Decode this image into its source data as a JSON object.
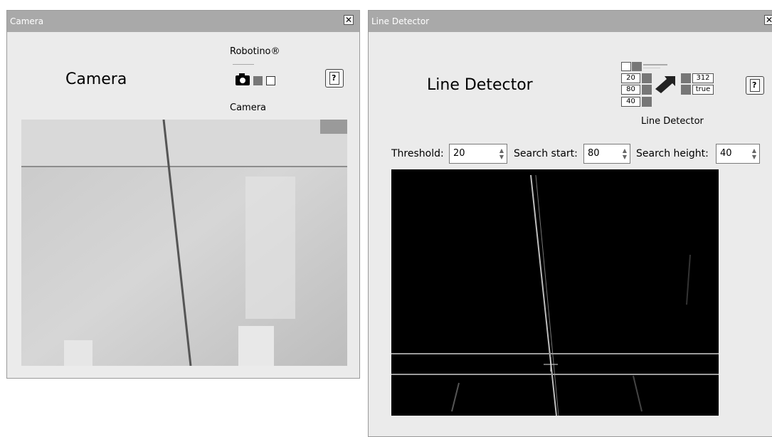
{
  "camera_window": {
    "title": "Camera",
    "close_label": "✕",
    "heading": "Camera",
    "brand": "Robotino®",
    "icon_caption": "Camera"
  },
  "line_detector_window": {
    "title": "Line Detector",
    "close_label": "✕",
    "heading": "Line Detector",
    "icon_caption": "Line Detector",
    "icon_inputs": [
      "20",
      "80",
      "40"
    ],
    "icon_outputs": [
      "312",
      "true"
    ],
    "fields": {
      "threshold": {
        "label": "Threshold:",
        "value": "20"
      },
      "search_start": {
        "label": "Search start:",
        "value": "80"
      },
      "search_height": {
        "label": "Search height:",
        "value": "40"
      }
    }
  },
  "colors": {
    "titlebar": "#a9a9a9",
    "panel_bg": "#ebebeb",
    "detector_bg": "#000000",
    "search_band_lines": "#9a9a9a"
  },
  "icons": [
    "close-icon",
    "help-icon",
    "camera-icon",
    "line-detector-block-icon"
  ]
}
